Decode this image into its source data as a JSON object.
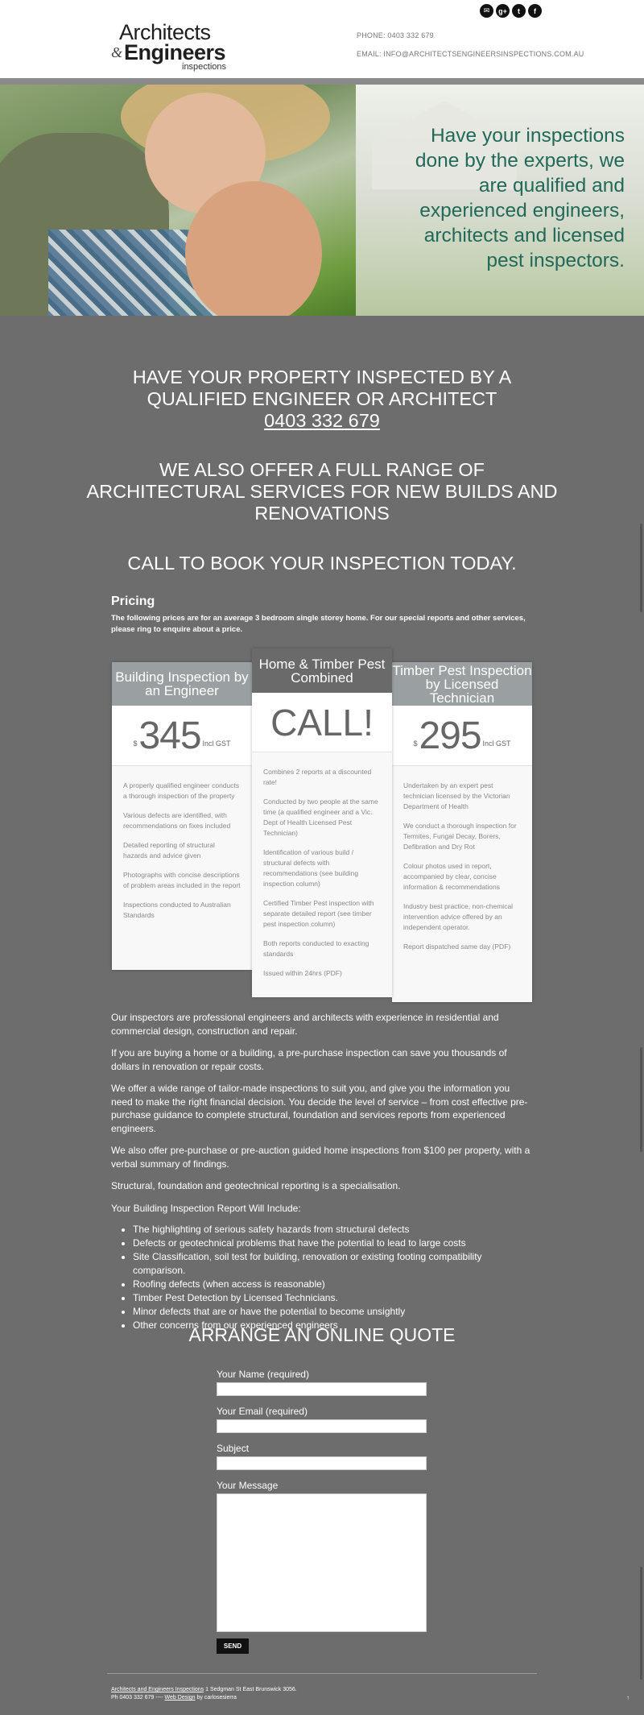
{
  "logo": {
    "line1": "Architects",
    "amp": "&",
    "line2": "Engineers",
    "line3": "inspections"
  },
  "contact": {
    "phone": "PHONE: 0403 332 679",
    "email": "EMAIL: INFO@ARCHITECTSENGINEERSINSPECTIONS.COM.AU"
  },
  "social": [
    {
      "icon": "email-icon",
      "glyph": "✉"
    },
    {
      "icon": "google-plus-icon",
      "glyph": "g+"
    },
    {
      "icon": "twitter-icon",
      "glyph": "t"
    },
    {
      "icon": "facebook-icon",
      "glyph": "f"
    }
  ],
  "hero": {
    "text": "Have your inspections done by the experts, we are qualified and experienced engineers, architects and licensed pest inspectors."
  },
  "headings": {
    "h1_line1": "HAVE YOUR PROPERTY INSPECTED BY A",
    "h1_line2": "QUALIFIED ENGINEER OR ARCHITECT",
    "h1_phone": "0403 332 679",
    "h2": "WE ALSO OFFER A FULL RANGE OF ARCHITECTURAL SERVICES FOR NEW BUILDS AND RENOVATIONS",
    "h3": "CALL TO BOOK YOUR INSPECTION TODAY."
  },
  "pricing": {
    "title": "Pricing",
    "intro": "The following prices are for an average 3 bedroom single storey home. For our special reports and other services, please ring to enquire about a price.",
    "cards": [
      {
        "title": "Building Inspection by an Engineer",
        "currency": "$",
        "amount": "345",
        "gst": "Incl GST",
        "features": [
          "A properly qualified engineer conducts a thorough inspection of the property",
          "Various defects are identified, with recommendations on fixes included",
          "Detailed reporting of structural hazards and advice given",
          "Photographs with concise descriptions of problem areas included in the report",
          "Inspections conducted to Australian Standards"
        ]
      },
      {
        "title": "Home & Timber Pest Combined",
        "amount": "CALL!",
        "features": [
          "Combines 2 reports at a discounted rate!",
          "Conducted by two people at the same time (a qualified engineer and a Vic. Dept of Health Licensed Pest Technician)",
          "Identification of various build / structural defects with recommendations (see building inspection column)",
          "Certified Timber Pest inspection with separate detailed report (see timber pest inspection column)",
          "Both reports conducted to exacting standards",
          "Issued within 24hrs (PDF)"
        ]
      },
      {
        "title": "Timber Pest Inspection by Licensed Technician",
        "currency": "$",
        "amount": "295",
        "gst": "Incl GST",
        "features": [
          "Undertaken by an expert pest technician licensed by the Victorian Department of Health",
          "We conduct a thorough inspection for Termites, Fungal Decay, Borers, Defibration and Dry Rot",
          "Colour photos used in report, accompanied by clear, concise information & recommendations",
          "Industry best practice, non-chemical intervention advice offered by an independent operator.",
          "Report dispatched same day (PDF)"
        ]
      }
    ]
  },
  "content": {
    "paragraphs": [
      "Our inspectors are professional engineers and architects with experience in residential and commercial design, construction and repair.",
      "If you are buying a home or a building, a pre-purchase inspection can save you thousands of dollars in renovation or repair costs.",
      "We offer a wide range of tailor-made inspections to suit you, and give you the information you need to make the right financial decision. You decide the level of service – from cost effective pre-purchase guidance to complete structural, foundation and services reports from experienced engineers.",
      "We also offer pre-purchase or pre-auction guided home inspections from $100 per property, with a verbal summary of findings.",
      "Structural, foundation and geotechnical reporting is a specialisation.",
      "Your Building Inspection Report Will Include:"
    ],
    "list": [
      "The highlighting of serious safety hazards from structural defects",
      "Defects or geotechnical problems that have the potential to lead to large costs",
      "Site Classification, soil test for building, renovation or existing footing compatibility comparison.",
      "Roofing defects (when access is reasonable)",
      "Timber Pest Detection by Licensed Technicians.",
      "Minor defects that are or have the potential to become unsightly",
      "Other concerns from our experienced engineers"
    ]
  },
  "quote": {
    "title": "ARRANGE AN ONLINE QUOTE",
    "name_label": "Your Name (required)",
    "email_label": "Your Email (required)",
    "subject_label": "Subject",
    "message_label": "Your Message",
    "send": "SEND"
  },
  "footer": {
    "company_link": "Architects and Engineers Inspections",
    "address": " 1 Sedgman St East Brunswick 3056.",
    "phone_prefix": "Ph 0403 332 679 ---- ",
    "web_design_link": "Web Design",
    "by": " by carlosesierra",
    "totop": "↑"
  },
  "colors": {
    "background": "#6d6d6d",
    "hero_text": "#21695a",
    "card_header": "#9aa0a1",
    "card_header_featured": "#6a6a6a"
  }
}
